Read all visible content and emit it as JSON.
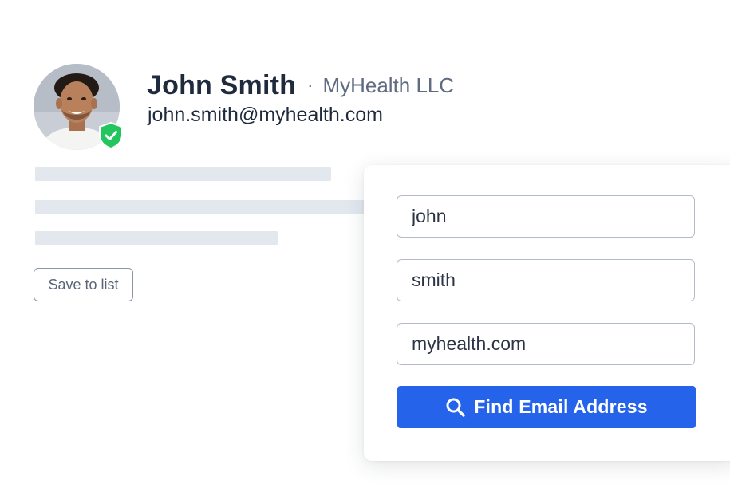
{
  "profile": {
    "name": "John Smith",
    "separator": "·",
    "company": "MyHealth LLC",
    "email": "john.smith@myhealth.com",
    "verified_icon": "shield-check-icon",
    "verified_color": "#22c55e"
  },
  "actions": {
    "save_label": "Save to list"
  },
  "finder": {
    "first_name": "john",
    "last_name": "smith",
    "domain": "myhealth.com",
    "button_label": "Find Email Address",
    "button_icon": "search-icon",
    "button_color": "#2563eb"
  }
}
